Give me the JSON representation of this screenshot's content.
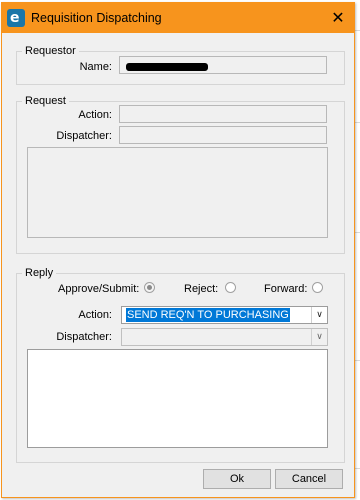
{
  "window": {
    "title": "Requisition Dispatching",
    "close_glyph": "✕",
    "app_icon": "e-app-icon",
    "app_icon_glyph": "e"
  },
  "colors": {
    "titlebar": "#f7941d",
    "selection": "#0078d7"
  },
  "requestor": {
    "legend": "Requestor",
    "name_label": "Name:",
    "name_value_redacted": true
  },
  "request": {
    "legend": "Request",
    "action_label": "Action:",
    "dispatcher_label": "Dispatcher:"
  },
  "reply": {
    "legend": "Reply",
    "options": [
      {
        "label": "Approve/Submit:",
        "checked": true
      },
      {
        "label": "Reject:",
        "checked": false
      },
      {
        "label": "Forward:",
        "checked": false
      }
    ],
    "action_label": "Action:",
    "action_value": "SEND REQ'N TO PURCHASING",
    "dispatcher_label": "Dispatcher:",
    "dispatcher_value": ""
  },
  "buttons": {
    "ok": "Ok",
    "cancel": "Cancel"
  },
  "icons": {
    "combo_arrow": "chevron-down-icon",
    "close": "close-icon",
    "radio": "radio-icon"
  }
}
